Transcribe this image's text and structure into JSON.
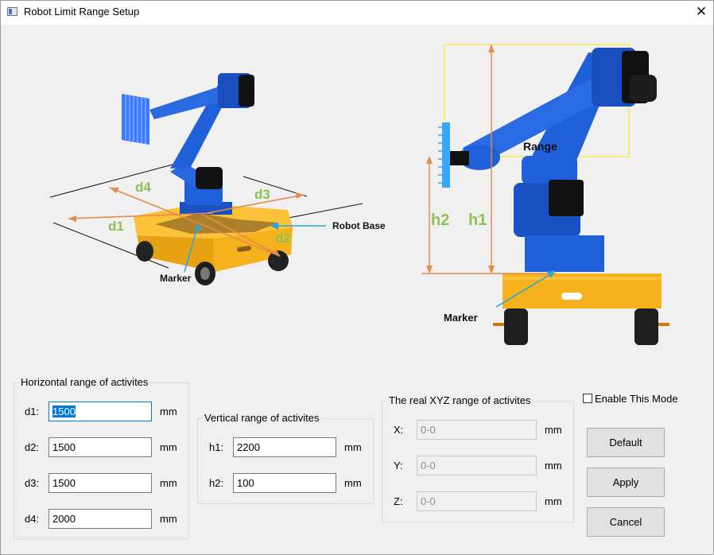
{
  "window": {
    "title": "Robot Limit Range Setup",
    "close_glyph": "✕",
    "icon": "app-window-icon"
  },
  "diagram_left": {
    "labels": {
      "d1": "d1",
      "d2": "d2",
      "d3": "d3",
      "d4": "d4",
      "robot_base": "Robot Base",
      "marker": "Marker"
    }
  },
  "diagram_right": {
    "labels": {
      "h1": "h1",
      "h2": "h2",
      "range": "Range",
      "marker": "Marker"
    }
  },
  "horizontal": {
    "title": "Horizontal range of activites",
    "rows": [
      {
        "label": "d1:",
        "value": "1500",
        "unit": "mm"
      },
      {
        "label": "d2:",
        "value": "1500",
        "unit": "mm"
      },
      {
        "label": "d3:",
        "value": "1500",
        "unit": "mm"
      },
      {
        "label": "d4:",
        "value": "2000",
        "unit": "mm"
      }
    ]
  },
  "vertical": {
    "title": "Vertical range of activites",
    "rows": [
      {
        "label": "h1:",
        "value": "2200",
        "unit": "mm"
      },
      {
        "label": "h2:",
        "value": "100",
        "unit": "mm"
      }
    ]
  },
  "real": {
    "title": "The real XYZ range of activites",
    "rows": [
      {
        "label": "X:",
        "value": "0-0",
        "unit": "mm"
      },
      {
        "label": "Y:",
        "value": "0-0",
        "unit": "mm"
      },
      {
        "label": "Z:",
        "value": "0-0",
        "unit": "mm"
      }
    ]
  },
  "enable_mode": {
    "label": "Enable This Mode",
    "checked": false
  },
  "buttons": {
    "default": "Default",
    "apply": "Apply",
    "cancel": "Cancel"
  },
  "colors": {
    "robot_blue": "#1f5fd8",
    "cart_yellow": "#f6b21c",
    "dim_green": "#8cc152",
    "dim_orange": "#e38b4a",
    "range_yellow": "#f2ee52",
    "pointer_blue": "#2aa6d9",
    "selection": "#0078d7"
  }
}
